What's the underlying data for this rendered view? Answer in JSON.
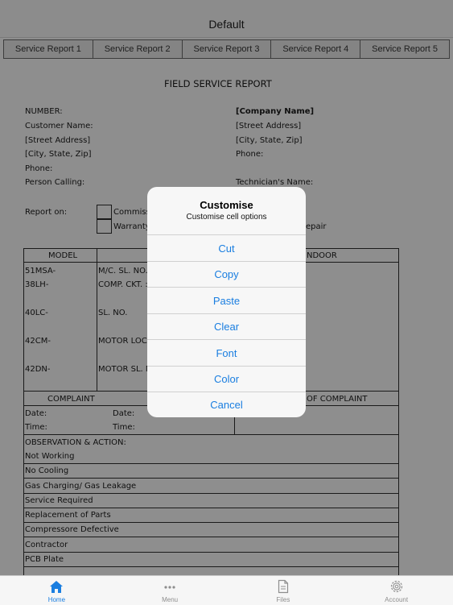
{
  "nav": {
    "title": "Default"
  },
  "tabs": [
    "Service Report 1",
    "Service Report 2",
    "Service Report 3",
    "Service Report 4",
    "Service Report 5"
  ],
  "report": {
    "title": "FIELD SERVICE REPORT",
    "left_fields": [
      "NUMBER:",
      "Customer Name:",
      "[Street Address]",
      "[City, State, Zip]",
      "Phone:",
      "Person Calling:"
    ],
    "right_fields": [
      "[Company Name]",
      "[Street Address]",
      "[City, State, Zip]",
      "Phone:",
      "",
      "Technician's Name:"
    ],
    "report_on_label": "Report on:",
    "report_on_options": [
      "Commissio",
      "Warranty"
    ],
    "repair_text": "epair",
    "model_header": "MODEL",
    "indoor_header": "NDOOR",
    "models": [
      "51MSA-",
      "38LH-",
      "40LC-",
      "42CM-",
      "42DN-"
    ],
    "model_details": [
      "M/C. SL. NO.",
      "COMP. CKT. :",
      "SL. NO.",
      "MOTOR LOCAT",
      "MOTOR SL. NO"
    ],
    "complaint_header": "COMPLAINT",
    "complaint_right_header": "OF COMPLAINT",
    "date_label": "Date:",
    "time_label": "Time:",
    "observation_header": "OBSERVATION & ACTION:",
    "observations": [
      "Not Working",
      "No Cooling",
      "Gas Charging/ Gas Leakage",
      "Service Required",
      "Replacement of Parts",
      "Compressore Defective",
      "Contractor",
      "PCB Plate"
    ]
  },
  "dialog": {
    "title": "Customise",
    "message": "Customise cell options",
    "buttons": [
      "Cut",
      "Copy",
      "Paste",
      "Clear",
      "Font",
      "Color",
      "Cancel"
    ]
  },
  "tabbar": {
    "items": [
      {
        "label": "Home",
        "icon": "home-icon",
        "active": true
      },
      {
        "label": "Menu",
        "icon": "more-icon",
        "active": false
      },
      {
        "label": "Files",
        "icon": "file-icon",
        "active": false
      },
      {
        "label": "Account",
        "icon": "gear-icon",
        "active": false
      }
    ],
    "active_color": "#1a7ee0",
    "inactive_color": "#8e8e8e"
  }
}
